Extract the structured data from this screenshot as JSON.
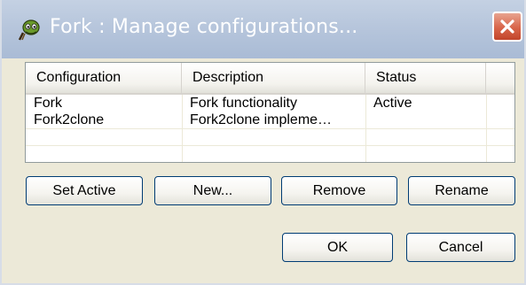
{
  "window": {
    "title": "Fork : Manage configurations...",
    "app_icon": "alien-head-icon",
    "close_icon": "close-icon"
  },
  "table": {
    "columns": [
      "Configuration",
      "Description",
      "Status"
    ],
    "rows": [
      {
        "configuration": "Fork",
        "description": "Fork functionality",
        "status": "Active"
      },
      {
        "configuration": "Fork2clone",
        "description": "Fork2clone impleme…",
        "status": ""
      }
    ]
  },
  "buttons": {
    "set_active": "Set Active",
    "new": "New...",
    "remove": "Remove",
    "rename": "Rename",
    "ok": "OK",
    "cancel": "Cancel"
  },
  "colors": {
    "titlebar": "#b7c6dc",
    "dialog_bg": "#ece9d8",
    "close_button": "#d8654a"
  }
}
